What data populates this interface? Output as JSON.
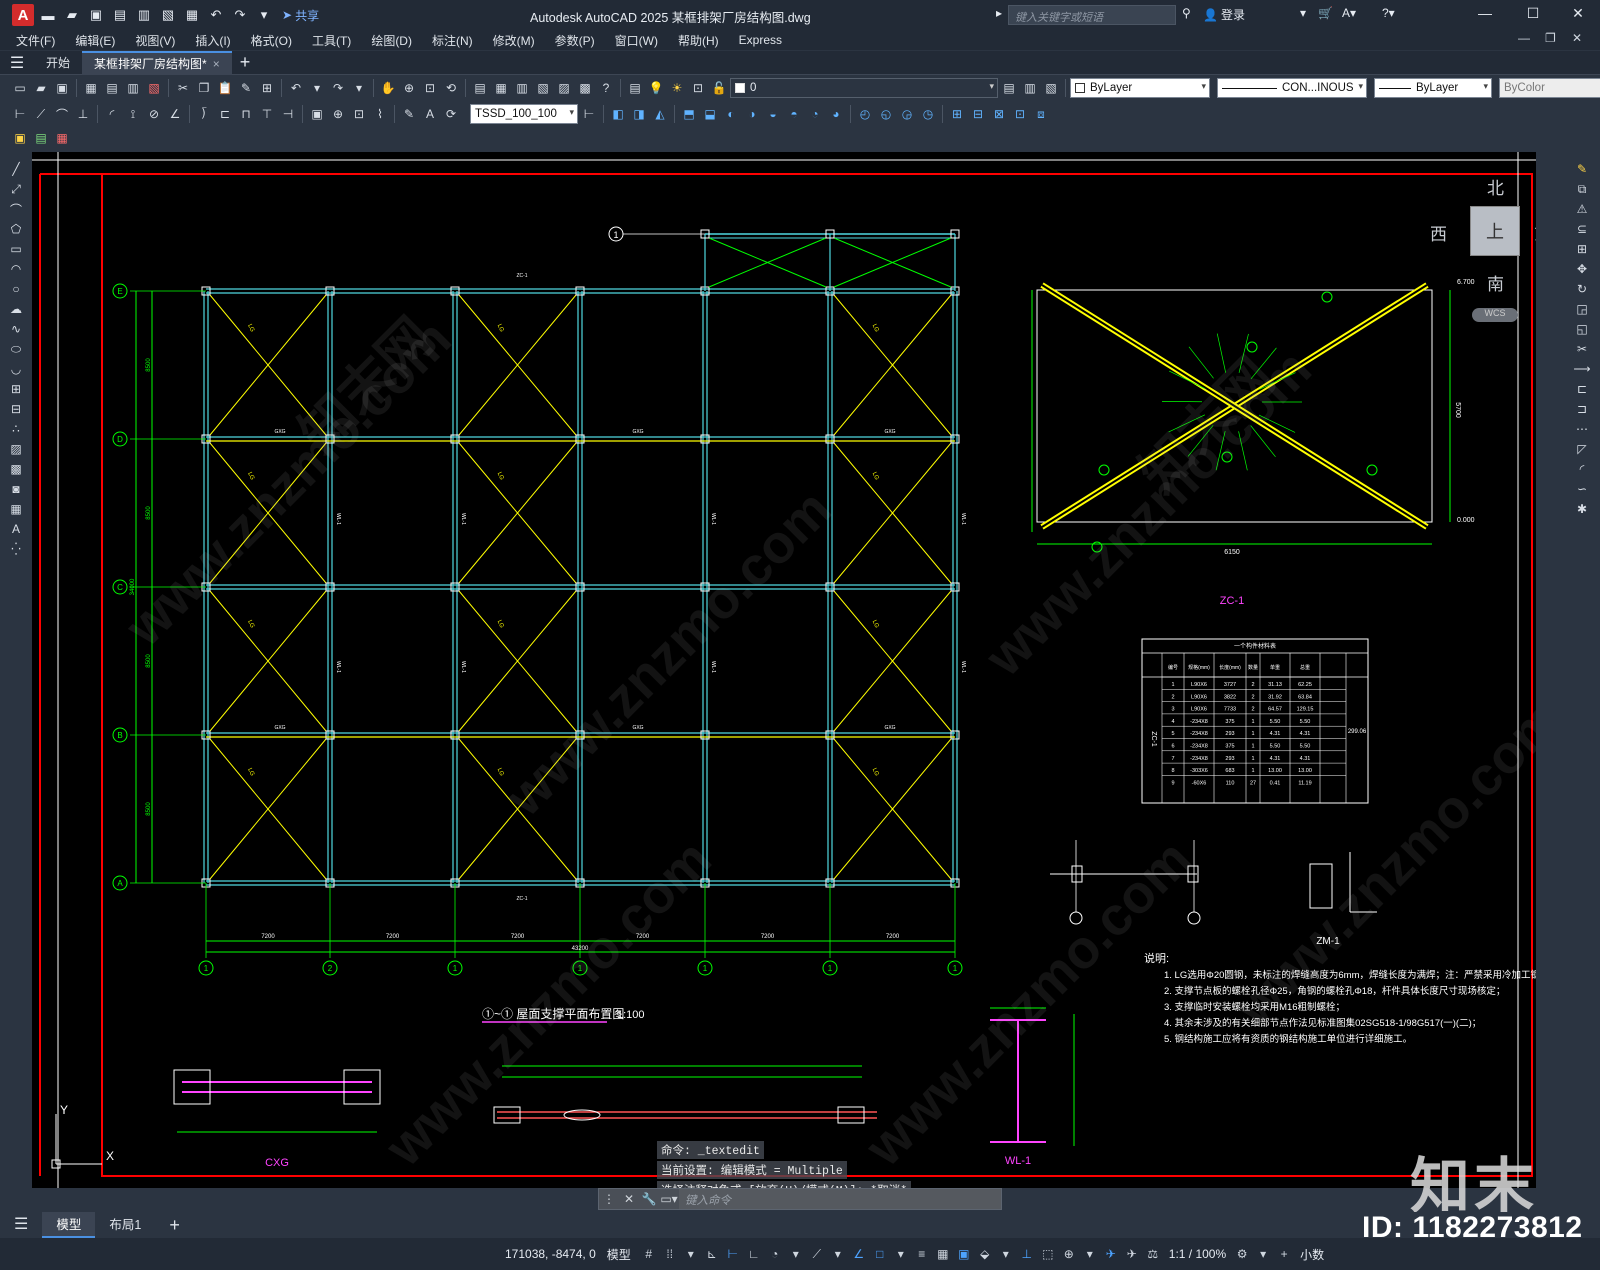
{
  "app": {
    "logo_text": "A",
    "title": "Autodesk AutoCAD 2025    某框排架厂房结构图.dwg",
    "search_placeholder": "键入关键字或短语",
    "login_label": "登录",
    "share_label": "共享"
  },
  "menu": [
    "文件(F)",
    "编辑(E)",
    "视图(V)",
    "插入(I)",
    "格式(O)",
    "工具(T)",
    "绘图(D)",
    "标注(N)",
    "修改(M)",
    "参数(P)",
    "窗口(W)",
    "帮助(H)",
    "Express"
  ],
  "doc_tabs": {
    "start": "开始",
    "active": "某框排架厂房结构图*",
    "close_glyph": "×",
    "new_glyph": "+"
  },
  "toolbar": {
    "layer_value": "0",
    "color_value": "ByLayer",
    "linetype_value": "CON...INOUS",
    "lineweight_value": "ByLayer",
    "plotstyle_value": "ByColor",
    "dimstyle_value": "TSSD_100_100"
  },
  "viewcube": {
    "north": "北",
    "south": "南",
    "east": "东",
    "west": "西",
    "face": "上",
    "wcs": "WCS"
  },
  "drawing": {
    "plan_title": "①~① 屋面支撑平面布置图",
    "plan_scale": "1:100",
    "detail_title": "ZC-1",
    "zm_title": "ZM-1",
    "cxg_title": "CXG",
    "wl_title": "WL-1",
    "table_title": "一个构件材料表",
    "table_side": "ZC-1",
    "table_total": "299.06",
    "table_headers": [
      "编号",
      "规格(mm)",
      "长度(mm)",
      "数量",
      "单重",
      "总重"
    ],
    "table_rows": [
      [
        "1",
        "L90X6",
        "3727",
        "2",
        "31.13",
        "62.25"
      ],
      [
        "2",
        "L90X6",
        "3822",
        "2",
        "31.92",
        "63.84"
      ],
      [
        "3",
        "L90X6",
        "7733",
        "2",
        "64.57",
        "129.15"
      ],
      [
        "4",
        "-234X8",
        "375",
        "1",
        "5.50",
        "5.50"
      ],
      [
        "5",
        "-234X8",
        "293",
        "1",
        "4.31",
        "4.31"
      ],
      [
        "6",
        "-234X8",
        "375",
        "1",
        "5.50",
        "5.50"
      ],
      [
        "7",
        "-234X8",
        "293",
        "1",
        "4.31",
        "4.31"
      ],
      [
        "8",
        "-303X6",
        "683",
        "1",
        "13.00",
        "13.00"
      ],
      [
        "9",
        "-60X6",
        "110",
        "27",
        "0.41",
        "11.19"
      ]
    ],
    "notes_title": "说明:",
    "notes": [
      "1. LG选用Φ20圆钢，未标注的焊缝高度为6mm，焊缝长度为满焊；注：严禁采用冷加工钢筋",
      "2. 支撑节点板的螺栓孔径Φ25，角钢的螺栓孔Φ18，杆件具体长度尺寸现场核定；",
      "3. 支撑临时安装螺栓均采用M16粗制螺栓；",
      "4. 其余未涉及的有关细部节点作法见标准图集02SG518-1/98G517(一)(二)；",
      "5. 钢结构施工应将有资质的钢结构施工单位进行详细施工。"
    ],
    "row_labels": [
      "E",
      "D",
      "C",
      "B",
      "A"
    ],
    "col_labels": [
      "1",
      "2",
      "1",
      "1",
      "1",
      "1",
      "1"
    ],
    "bay_dims": [
      "7200",
      "7200",
      "7200",
      "7200",
      "7200",
      "7200"
    ],
    "total_dim": "43200",
    "row_dims": [
      "8500",
      "8500",
      "8500",
      "8500"
    ],
    "total_row_dim": "34000",
    "beam_label": "GXG",
    "brace_label": "LG",
    "column_label": "WL-1",
    "zc_label": "ZC-1",
    "elev_top": "6.700",
    "elev_bot": "0.000",
    "zc_width": "6150",
    "zc_height": "5700",
    "y_axis": "Y",
    "x_axis": "X"
  },
  "command": {
    "history": [
      "命令: _textedit",
      "当前设置: 编辑模式 = Multiple",
      "选择注释对象或 [放弃(U)/模式(M)]: *取消*"
    ],
    "placeholder": "键入命令"
  },
  "layout_tabs": [
    "模型",
    "布局1"
  ],
  "status": {
    "coords": "171038, -8474, 0",
    "model": "模型",
    "scale": "1:1 / 100%",
    "units": "小数"
  },
  "overlay": {
    "watermark": "www.znzmo.com",
    "watermark_cn": "知末网",
    "logo": "知末",
    "image_id": "ID: 1182273812"
  },
  "colors": {
    "title_bg": "#222a36",
    "panel_bg": "#2b3441",
    "canvas_bg": "#000000",
    "frame_red": "#ff0000",
    "grid_cyan": "#4fd8e0",
    "brace_yellow": "#ffff00",
    "dim_green": "#00ff00",
    "accent_blue": "#4a90e2"
  }
}
